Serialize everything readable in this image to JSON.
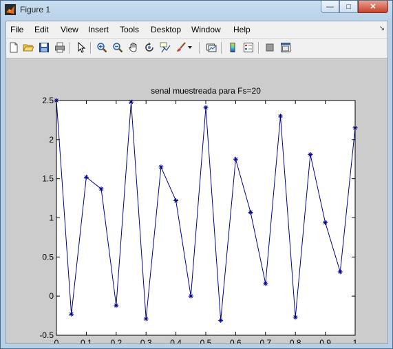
{
  "window": {
    "title": "Figure 1",
    "controls": {
      "minimize": "—",
      "maximize": "□",
      "close": "✕"
    }
  },
  "menu": {
    "items": [
      "File",
      "Edit",
      "View",
      "Insert",
      "Tools",
      "Desktop",
      "Window",
      "Help"
    ],
    "dock_glyph": "↘"
  },
  "toolbar": {
    "icons": [
      "new-figure-icon",
      "open-file-icon",
      "save-icon",
      "print-icon",
      "edit-plot-arrow-icon",
      "zoom-in-icon",
      "zoom-out-icon",
      "pan-hand-icon",
      "rotate-3d-icon",
      "data-cursor-icon",
      "brush-icon",
      "brush-dropdown-icon",
      "link-plot-icon",
      "insert-colorbar-icon",
      "insert-legend-icon",
      "hide-plot-tools-icon",
      "show-plot-tools-icon"
    ]
  },
  "colors": {
    "series": "#00008b",
    "axes_bg": "#ffffff",
    "figure_bg": "#cccccc"
  },
  "chart_data": {
    "type": "line",
    "title": "senal muestreada para Fs=20",
    "xlabel": "",
    "ylabel": "",
    "xlim": [
      0,
      1
    ],
    "ylim": [
      -0.5,
      2.5
    ],
    "xticks": [
      "0",
      "0.1",
      "0.2",
      "0.3",
      "0.4",
      "0.5",
      "0.6",
      "0.7",
      "0.8",
      "0.9",
      "1"
    ],
    "yticks": [
      "-0.5",
      "0",
      "0.5",
      "1",
      "1.5",
      "2",
      "2.5"
    ],
    "grid": false,
    "marker": "*",
    "series": [
      {
        "x": [
          0,
          0.05,
          0.1,
          0.15,
          0.2,
          0.25,
          0.3,
          0.35,
          0.4,
          0.45,
          0.5,
          0.55,
          0.6,
          0.65,
          0.7,
          0.75,
          0.8,
          0.85,
          0.9,
          0.95,
          1.0
        ],
        "values": [
          2.5,
          -0.23,
          1.52,
          1.37,
          -0.12,
          2.48,
          -0.29,
          1.65,
          1.22,
          0.0,
          2.41,
          -0.31,
          1.75,
          1.07,
          0.16,
          2.3,
          -0.27,
          1.81,
          0.94,
          0.31,
          2.15
        ]
      }
    ]
  }
}
